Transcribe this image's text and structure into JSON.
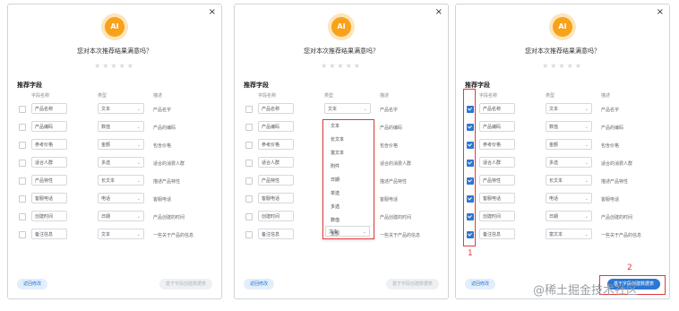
{
  "dialog": {
    "close_label": "×",
    "ai_label": "AI",
    "question": "您对本次推荐结果满意吗？",
    "stars": "★★★★★",
    "section_title": "推荐字段",
    "header_name": "字段名称",
    "header_type": "类型",
    "header_desc": "描述",
    "back_button": "返回修改",
    "generate_button": "基于字段创建数据表"
  },
  "panel1": {
    "rows": [
      {
        "name": "产品名称",
        "type": "文本",
        "desc": "产品名字",
        "checked": false
      },
      {
        "name": "产品编码",
        "type": "数值",
        "desc": "产品的编码",
        "checked": false
      },
      {
        "name": "参考价格",
        "type": "金额",
        "desc": "包含价格",
        "checked": false
      },
      {
        "name": "适合人群",
        "type": "多选",
        "desc": "适合的消费人群",
        "checked": false
      },
      {
        "name": "产品特性",
        "type": "长文本",
        "desc": "描述产品特性",
        "checked": false
      },
      {
        "name": "客服电话",
        "type": "电话",
        "desc": "客服电话",
        "checked": false
      },
      {
        "name": "创建时间",
        "type": "日期",
        "desc": "产品创建的时间",
        "checked": false
      },
      {
        "name": "备注信息",
        "type": "文本",
        "desc": "一些关于产品的信息",
        "checked": false
      }
    ]
  },
  "panel2": {
    "rows": [
      {
        "name": "产品名称",
        "type": "文本",
        "desc": "产品名字",
        "checked": false
      },
      {
        "name": "产品编码",
        "desc": "产品的编码",
        "checked": false
      },
      {
        "name": "参考价格",
        "desc": "包含价格",
        "checked": false
      },
      {
        "name": "适合人群",
        "desc": "适合的消费人群",
        "checked": false
      },
      {
        "name": "产品特性",
        "desc": "描述产品特性",
        "checked": false
      },
      {
        "name": "客服电话",
        "desc": "客服电话",
        "checked": false
      },
      {
        "name": "创建时间",
        "desc": "产品创建的时间",
        "checked": false
      },
      {
        "name": "备注信息",
        "desc": "一些关于产品的信息",
        "checked": false
      }
    ],
    "dropdown_options": [
      "文本",
      "长文本",
      "富文本",
      "附件",
      "日期",
      "单选",
      "多选",
      "数值",
      "金额"
    ],
    "dropdown_selected": "文本"
  },
  "panel3": {
    "rows": [
      {
        "name": "产品名称",
        "type": "文本",
        "desc": "产品名字",
        "checked": true
      },
      {
        "name": "产品编码",
        "type": "数值",
        "desc": "产品的编码",
        "checked": true
      },
      {
        "name": "参考价格",
        "type": "金额",
        "desc": "包含价格",
        "checked": true
      },
      {
        "name": "适合人群",
        "type": "多选",
        "desc": "适合的消费人群",
        "checked": true
      },
      {
        "name": "产品特性",
        "type": "长文本",
        "desc": "描述产品特性",
        "checked": true
      },
      {
        "name": "客服电话",
        "type": "电话",
        "desc": "客服电话",
        "checked": true
      },
      {
        "name": "创建时间",
        "type": "日期",
        "desc": "产品创建的时间",
        "checked": true
      },
      {
        "name": "备注信息",
        "type": "富文本",
        "desc": "一些关于产品的信息",
        "checked": true
      }
    ]
  },
  "annotations": {
    "one": "1",
    "two": "2"
  },
  "watermark": "@稀土掘金技术社区",
  "colors": {
    "accent": "#2a78d5",
    "highlight": "#e33b3b",
    "ai_badge": "#f7a21a"
  }
}
